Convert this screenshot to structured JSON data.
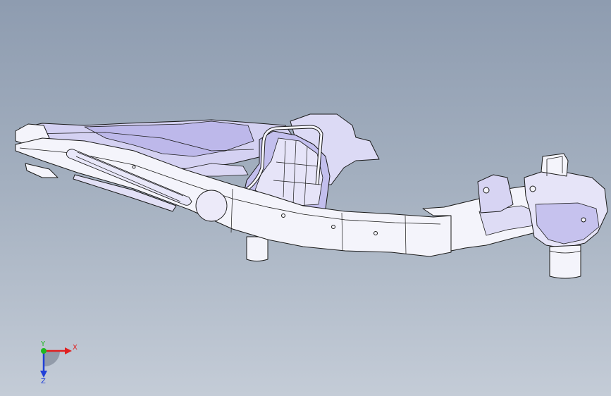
{
  "viewport": {
    "background_top": "#8e9cb0",
    "background_bottom": "#c4ccd7"
  },
  "model": {
    "fill_color": "#f4f4fb",
    "shade_color": "#c9c6ee",
    "deep_shade_color": "#a8a4de",
    "edge_color": "#1a1a1a"
  },
  "triad": {
    "x_label": "X",
    "y_label": "Y",
    "z_label": "Z",
    "x_color": "#e02020",
    "y_color": "#1fb81f",
    "z_color": "#2040d8"
  }
}
